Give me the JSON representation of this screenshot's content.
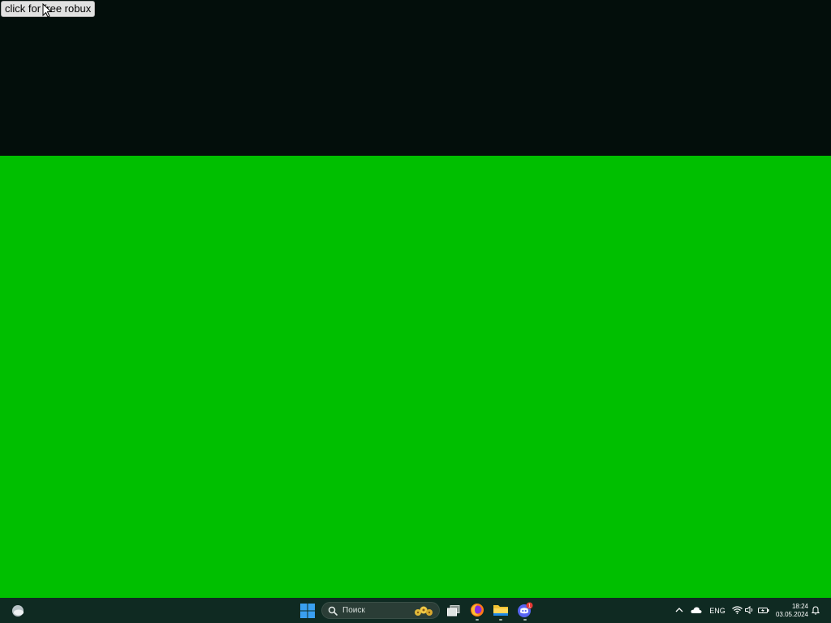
{
  "desktop": {
    "button_label": "click for free robux",
    "top_band_color": "#030e0b",
    "background_color": "#00bf00"
  },
  "taskbar": {
    "background_color": "#0f2a22",
    "search_placeholder": "Поиск",
    "pinned_apps": [
      "task-view",
      "firefox",
      "file-explorer",
      "discord"
    ],
    "discord_badge": "1",
    "tray": {
      "language": "ENG",
      "time": "18:24",
      "date": "03.05.2024"
    }
  }
}
